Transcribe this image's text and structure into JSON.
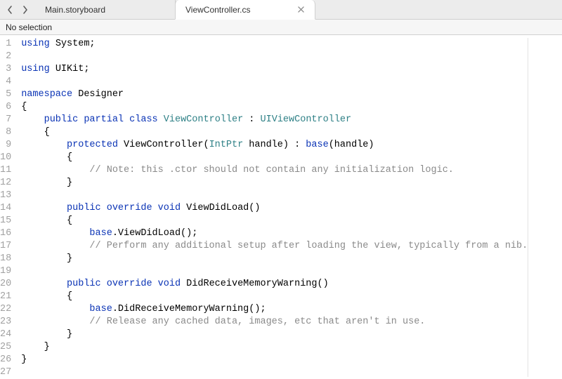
{
  "tabs": [
    {
      "label": "Main.storyboard",
      "active": false,
      "closeable": false
    },
    {
      "label": "ViewController.cs",
      "active": true,
      "closeable": true
    }
  ],
  "selection_text": "No selection",
  "code_lines": [
    {
      "n": 1,
      "tokens": [
        [
          "kw",
          "using"
        ],
        [
          "",
          " System;"
        ]
      ]
    },
    {
      "n": 2,
      "tokens": []
    },
    {
      "n": 3,
      "tokens": [
        [
          "kw",
          "using"
        ],
        [
          "",
          " UIKit;"
        ]
      ]
    },
    {
      "n": 4,
      "tokens": []
    },
    {
      "n": 5,
      "tokens": [
        [
          "kw",
          "namespace"
        ],
        [
          "",
          " Designer"
        ]
      ]
    },
    {
      "n": 6,
      "tokens": [
        [
          "",
          "{"
        ]
      ]
    },
    {
      "n": 7,
      "tokens": [
        [
          "",
          "    "
        ],
        [
          "kw",
          "public"
        ],
        [
          "",
          " "
        ],
        [
          "kw",
          "partial"
        ],
        [
          "",
          " "
        ],
        [
          "kw",
          "class"
        ],
        [
          "",
          " "
        ],
        [
          "type",
          "ViewController"
        ],
        [
          "",
          " : "
        ],
        [
          "type",
          "UIViewController"
        ]
      ]
    },
    {
      "n": 8,
      "tokens": [
        [
          "",
          "    {"
        ]
      ]
    },
    {
      "n": 9,
      "tokens": [
        [
          "",
          "        "
        ],
        [
          "kw",
          "protected"
        ],
        [
          "",
          " ViewController("
        ],
        [
          "type",
          "IntPtr"
        ],
        [
          "",
          " handle) : "
        ],
        [
          "kw",
          "base"
        ],
        [
          "",
          "(handle)"
        ]
      ]
    },
    {
      "n": 10,
      "tokens": [
        [
          "",
          "        {"
        ]
      ]
    },
    {
      "n": 11,
      "tokens": [
        [
          "",
          "            "
        ],
        [
          "cmt",
          "// Note: this .ctor should not contain any initialization logic."
        ]
      ]
    },
    {
      "n": 12,
      "tokens": [
        [
          "",
          "        }"
        ]
      ]
    },
    {
      "n": 13,
      "tokens": []
    },
    {
      "n": 14,
      "tokens": [
        [
          "",
          "        "
        ],
        [
          "kw",
          "public"
        ],
        [
          "",
          " "
        ],
        [
          "kw",
          "override"
        ],
        [
          "",
          " "
        ],
        [
          "kw",
          "void"
        ],
        [
          "",
          " ViewDidLoad()"
        ]
      ]
    },
    {
      "n": 15,
      "tokens": [
        [
          "",
          "        {"
        ]
      ]
    },
    {
      "n": 16,
      "tokens": [
        [
          "",
          "            "
        ],
        [
          "kw",
          "base"
        ],
        [
          "",
          ".ViewDidLoad();"
        ]
      ]
    },
    {
      "n": 17,
      "tokens": [
        [
          "",
          "            "
        ],
        [
          "cmt",
          "// Perform any additional setup after loading the view, typically from a nib."
        ]
      ]
    },
    {
      "n": 18,
      "tokens": [
        [
          "",
          "        }"
        ]
      ]
    },
    {
      "n": 19,
      "tokens": []
    },
    {
      "n": 20,
      "tokens": [
        [
          "",
          "        "
        ],
        [
          "kw",
          "public"
        ],
        [
          "",
          " "
        ],
        [
          "kw",
          "override"
        ],
        [
          "",
          " "
        ],
        [
          "kw",
          "void"
        ],
        [
          "",
          " DidReceiveMemoryWarning()"
        ]
      ]
    },
    {
      "n": 21,
      "tokens": [
        [
          "",
          "        {"
        ]
      ]
    },
    {
      "n": 22,
      "tokens": [
        [
          "",
          "            "
        ],
        [
          "kw",
          "base"
        ],
        [
          "",
          ".DidReceiveMemoryWarning();"
        ]
      ]
    },
    {
      "n": 23,
      "tokens": [
        [
          "",
          "            "
        ],
        [
          "cmt",
          "// Release any cached data, images, etc that aren't in use."
        ]
      ]
    },
    {
      "n": 24,
      "tokens": [
        [
          "",
          "        }"
        ]
      ]
    },
    {
      "n": 25,
      "tokens": [
        [
          "",
          "    }"
        ]
      ]
    },
    {
      "n": 26,
      "tokens": [
        [
          "",
          "}"
        ]
      ]
    },
    {
      "n": 27,
      "tokens": []
    }
  ]
}
